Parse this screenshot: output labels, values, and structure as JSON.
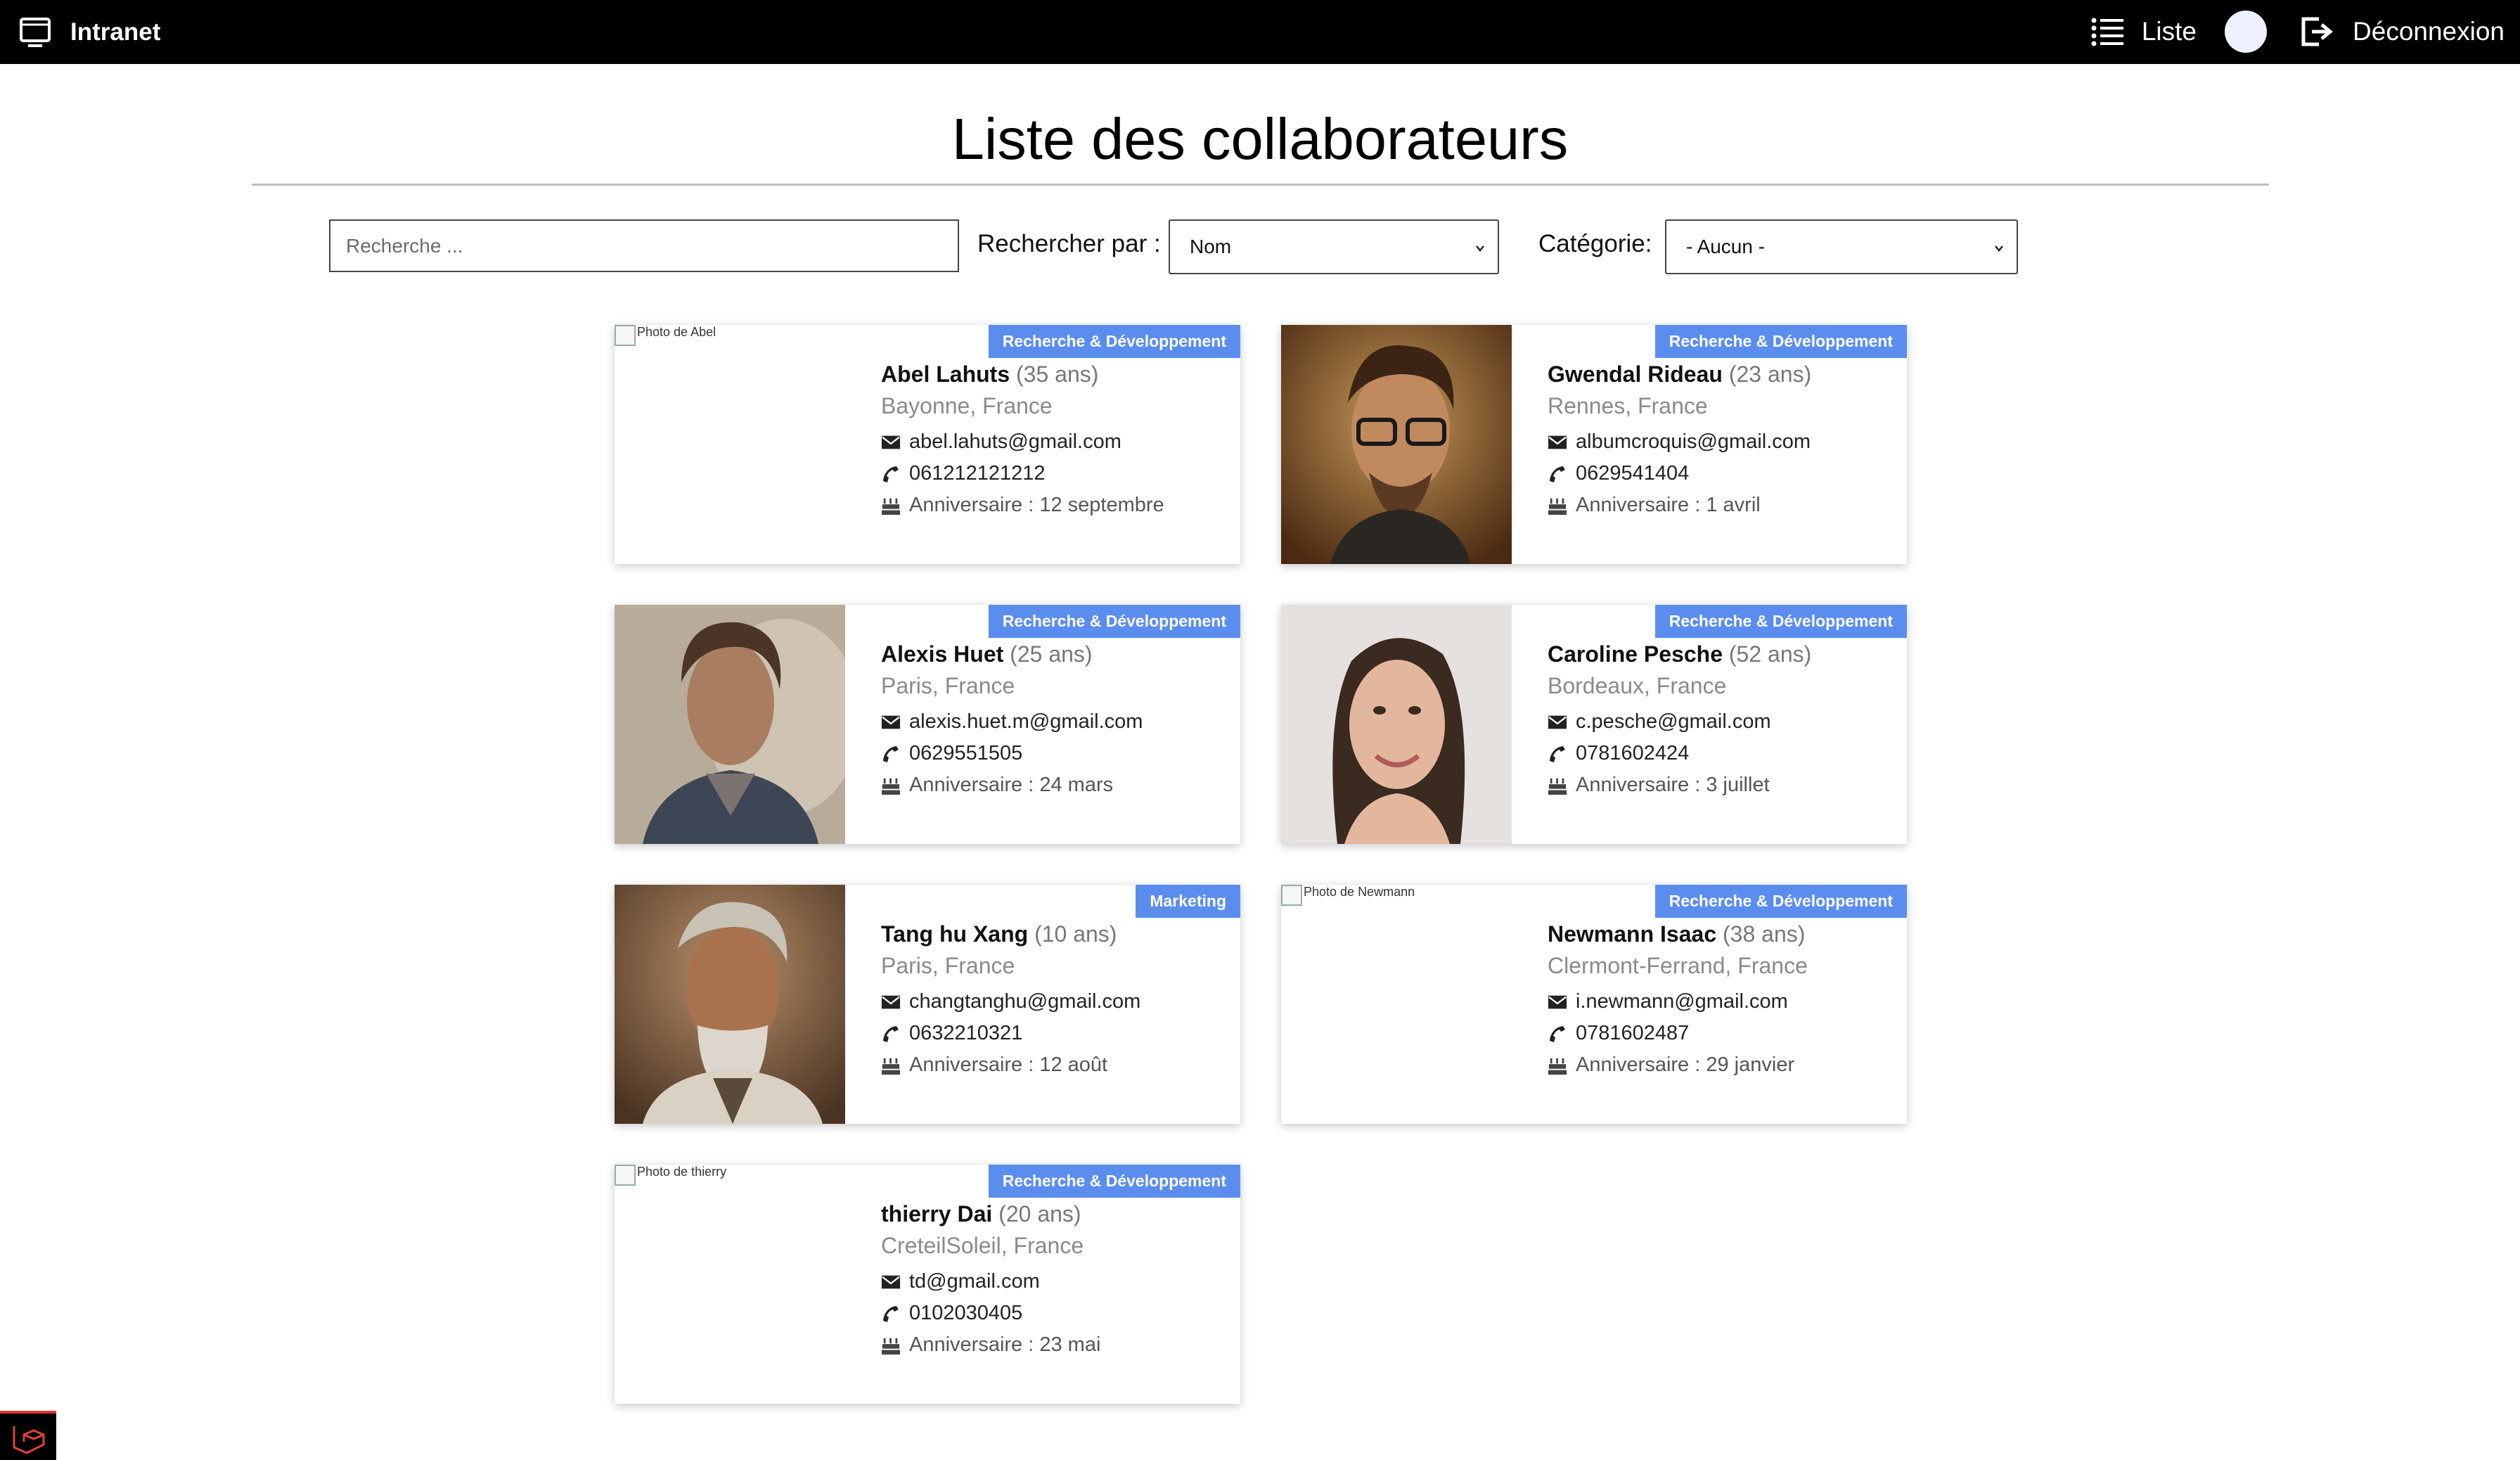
{
  "nav": {
    "brand": "Intranet",
    "list_label": "Liste",
    "logout_label": "Déconnexion"
  },
  "page": {
    "title": "Liste des collaborateurs"
  },
  "filters": {
    "search_placeholder": "Recherche ...",
    "search_by_label": "Rechercher par :",
    "search_by_value": "Nom",
    "category_label": "Catégorie:",
    "category_value": "- Aucun -"
  },
  "colors": {
    "badge": "#5b8def",
    "navbar": "#000000"
  },
  "cards": [
    {
      "name": "Abel Lahuts",
      "age": "(35 ans)",
      "city": "Bayonne, France",
      "email": "abel.lahuts@gmail.com",
      "phone": "061212121212",
      "birthday": "Anniversaire : 12 septembre",
      "category": "Recherche & Développement",
      "photo_alt": "Photo de Abel"
    },
    {
      "name": "Gwendal Rideau",
      "age": "(23 ans)",
      "city": "Rennes, France",
      "email": "albumcroquis@gmail.com",
      "phone": "0629541404",
      "birthday": "Anniversaire : 1 avril",
      "category": "Recherche & Développement",
      "photo_alt": ""
    },
    {
      "name": "Alexis Huet",
      "age": "(25 ans)",
      "city": "Paris, France",
      "email": "alexis.huet.m@gmail.com",
      "phone": "0629551505",
      "birthday": "Anniversaire : 24 mars",
      "category": "Recherche & Développement",
      "photo_alt": ""
    },
    {
      "name": "Caroline Pesche",
      "age": "(52 ans)",
      "city": "Bordeaux, France",
      "email": "c.pesche@gmail.com",
      "phone": "0781602424",
      "birthday": "Anniversaire : 3 juillet",
      "category": "Recherche & Développement",
      "photo_alt": ""
    },
    {
      "name": "Tang hu Xang",
      "age": "(10 ans)",
      "city": "Paris, France",
      "email": "changtanghu@gmail.com",
      "phone": "0632210321",
      "birthday": "Anniversaire : 12 août",
      "category": "Marketing",
      "photo_alt": ""
    },
    {
      "name": "Newmann Isaac",
      "age": "(38 ans)",
      "city": "Clermont-Ferrand, France",
      "email": "i.newmann@gmail.com",
      "phone": "0781602487",
      "birthday": "Anniversaire : 29 janvier",
      "category": "Recherche & Développement",
      "photo_alt": "Photo de Newmann"
    },
    {
      "name": "thierry Dai",
      "age": "(20 ans)",
      "city": "CreteilSoleil, France",
      "email": "td@gmail.com",
      "phone": "0102030405",
      "birthday": "Anniversaire : 23 mai",
      "category": "Recherche & Développement",
      "photo_alt": "Photo de thierry"
    }
  ]
}
